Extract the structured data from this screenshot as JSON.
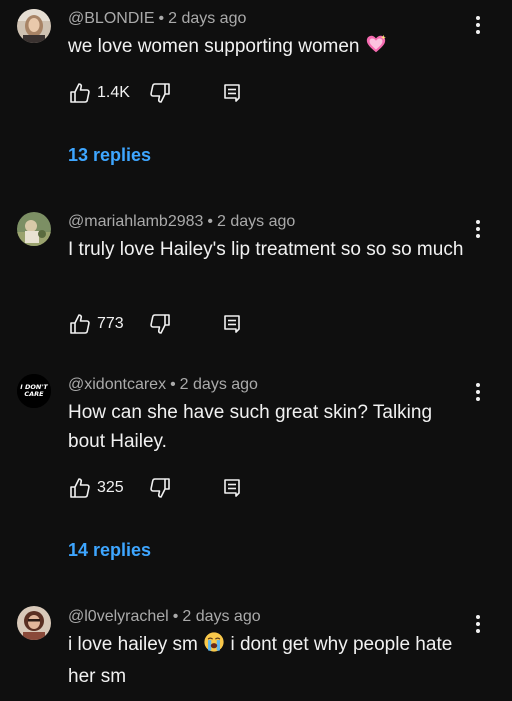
{
  "comments": [
    {
      "author": "@BLONDIE",
      "time": "2 days ago",
      "text": "we love women supporting women",
      "emoji": "sparkling-heart",
      "likes": "1.4K",
      "replies": "13 replies"
    },
    {
      "author": "@mariahlamb2983",
      "time": "2 days ago",
      "text": "I truly love Hailey's lip treatment so so so much",
      "likes": "773"
    },
    {
      "author": "@xidontcarex",
      "time": "2 days ago",
      "text": "How can she have such great skin? Talking bout Hailey.",
      "likes": "325",
      "replies": "14 replies",
      "avatar_text": "I DON'T CARE"
    },
    {
      "author": "@l0velyrachel",
      "time": "2 days ago",
      "text_before": "i love hailey sm",
      "emoji": "loudly-crying-face",
      "text_after": "i dont get why people hate her sm"
    }
  ],
  "separator": "•",
  "colors": {
    "background": "#0f0f0f",
    "text": "#f1f1f1",
    "meta": "#aaaaaa",
    "link": "#3ea6ff"
  }
}
